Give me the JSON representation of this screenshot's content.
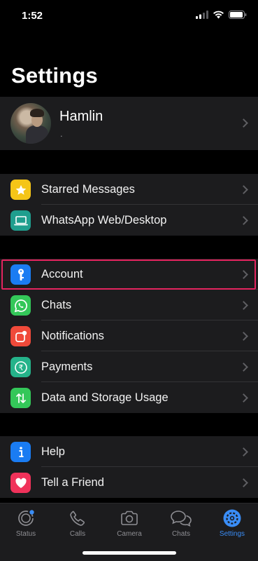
{
  "status_bar": {
    "time": "1:52"
  },
  "header": {
    "title": "Settings"
  },
  "profile": {
    "name": "Hamlin",
    "status": "."
  },
  "groups": {
    "starred": {
      "label": "Starred Messages",
      "color": "#f5c518"
    },
    "web": {
      "label": "WhatsApp Web/Desktop",
      "color": "#1f9e8e"
    },
    "account": {
      "label": "Account",
      "color": "#1a7cf2"
    },
    "chats": {
      "label": "Chats",
      "color": "#34c759"
    },
    "notifications": {
      "label": "Notifications",
      "color": "#f04a3a"
    },
    "payments": {
      "label": "Payments",
      "color": "#25b38a"
    },
    "storage": {
      "label": "Data and Storage Usage",
      "color": "#34c759"
    },
    "help": {
      "label": "Help",
      "color": "#1a7cf2"
    },
    "tell_friend": {
      "label": "Tell a Friend",
      "color": "#f0325a"
    }
  },
  "tabs": [
    {
      "label": "Status"
    },
    {
      "label": "Calls"
    },
    {
      "label": "Camera"
    },
    {
      "label": "Chats"
    },
    {
      "label": "Settings"
    }
  ],
  "colors": {
    "accent": "#3a8df6",
    "highlight": "#e3245f"
  }
}
